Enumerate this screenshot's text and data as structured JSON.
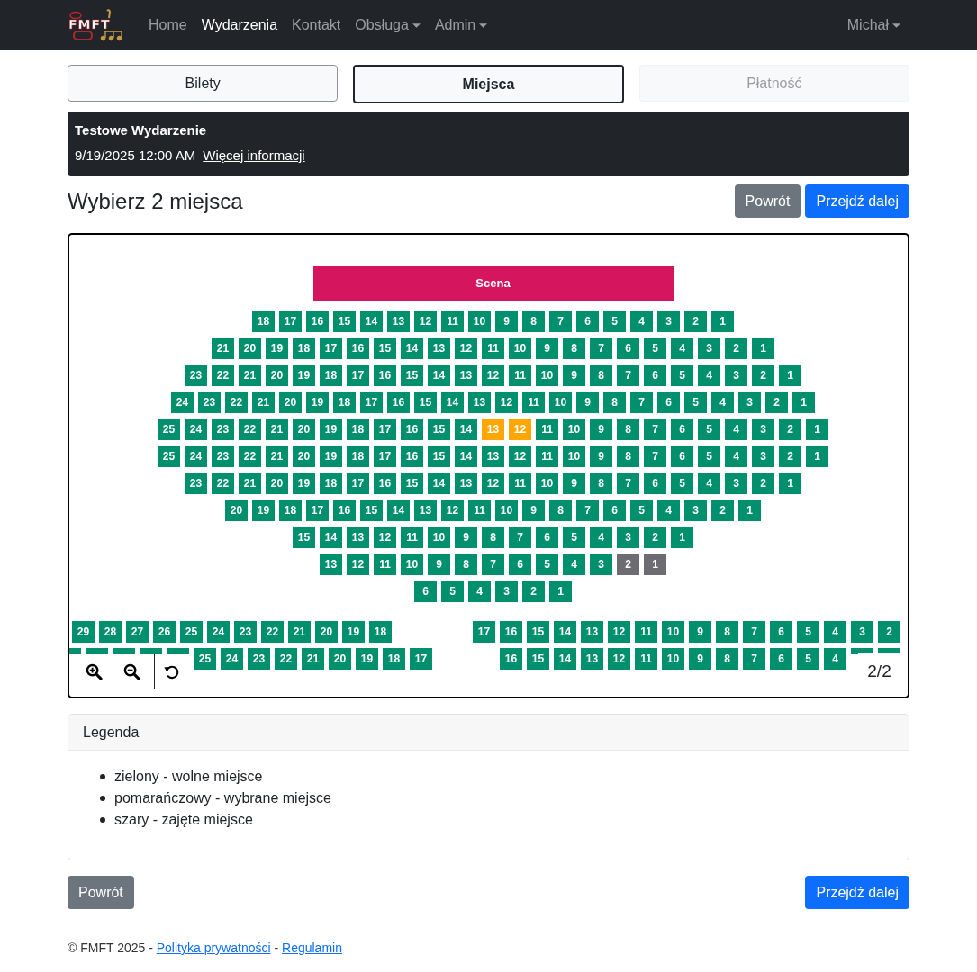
{
  "navbar": {
    "logo_text": "FMFT",
    "links": [
      {
        "label": "Home",
        "selected": false,
        "dropdown": false
      },
      {
        "label": "Wydarzenia",
        "selected": true,
        "dropdown": false
      },
      {
        "label": "Kontakt",
        "selected": false,
        "dropdown": false
      },
      {
        "label": "Obsługa",
        "selected": false,
        "dropdown": true
      },
      {
        "label": "Admin",
        "selected": false,
        "dropdown": true
      }
    ],
    "user": {
      "label": "Michał",
      "dropdown": true
    }
  },
  "steps": [
    {
      "label": "Bilety",
      "selected": false,
      "disabled": false
    },
    {
      "label": "Miejsca",
      "selected": true,
      "disabled": false
    },
    {
      "label": "Płatność",
      "selected": false,
      "disabled": true
    }
  ],
  "event": {
    "title": "Testowe Wydarzenie",
    "datetime": "9/19/2025 12:00 AM",
    "link": "Więcej informacji"
  },
  "heading": "Wybierz 2 miejsca",
  "top_buttons": [
    {
      "label": "Powrót",
      "kind": "secondary"
    },
    {
      "label": "Przejdź dalej",
      "kind": "primary"
    }
  ],
  "seat_map": {
    "stage": "Scena",
    "rows": [
      {
        "seats": [
          {
            "label": "18",
            "selected": false,
            "taken": false
          },
          {
            "label": "17",
            "selected": false,
            "taken": false
          },
          {
            "label": "16",
            "selected": false,
            "taken": false
          },
          {
            "label": "15",
            "selected": false,
            "taken": false
          },
          {
            "label": "14",
            "selected": false,
            "taken": false
          },
          {
            "label": "13",
            "selected": false,
            "taken": false
          },
          {
            "label": "12",
            "selected": false,
            "taken": false
          },
          {
            "label": "11",
            "selected": false,
            "taken": false
          },
          {
            "label": "10",
            "selected": false,
            "taken": false
          },
          {
            "label": "9",
            "selected": false,
            "taken": false
          },
          {
            "label": "8",
            "selected": false,
            "taken": false
          },
          {
            "label": "7",
            "selected": false,
            "taken": false
          },
          {
            "label": "6",
            "selected": false,
            "taken": false
          },
          {
            "label": "5",
            "selected": false,
            "taken": false
          },
          {
            "label": "4",
            "selected": false,
            "taken": false
          },
          {
            "label": "3",
            "selected": false,
            "taken": false
          },
          {
            "label": "2",
            "selected": false,
            "taken": false
          },
          {
            "label": "1",
            "selected": false,
            "taken": false
          }
        ]
      },
      {
        "seats": [
          {
            "label": "21",
            "selected": false,
            "taken": false
          },
          {
            "label": "20",
            "selected": false,
            "taken": false
          },
          {
            "label": "19",
            "selected": false,
            "taken": false
          },
          {
            "label": "18",
            "selected": false,
            "taken": false
          },
          {
            "label": "17",
            "selected": false,
            "taken": false
          },
          {
            "label": "16",
            "selected": false,
            "taken": false
          },
          {
            "label": "15",
            "selected": false,
            "taken": false
          },
          {
            "label": "14",
            "selected": false,
            "taken": false
          },
          {
            "label": "13",
            "selected": false,
            "taken": false
          },
          {
            "label": "12",
            "selected": false,
            "taken": false
          },
          {
            "label": "11",
            "selected": false,
            "taken": false
          },
          {
            "label": "10",
            "selected": false,
            "taken": false
          },
          {
            "label": "9",
            "selected": false,
            "taken": false
          },
          {
            "label": "8",
            "selected": false,
            "taken": false
          },
          {
            "label": "7",
            "selected": false,
            "taken": false
          },
          {
            "label": "6",
            "selected": false,
            "taken": false
          },
          {
            "label": "5",
            "selected": false,
            "taken": false
          },
          {
            "label": "4",
            "selected": false,
            "taken": false
          },
          {
            "label": "3",
            "selected": false,
            "taken": false
          },
          {
            "label": "2",
            "selected": false,
            "taken": false
          },
          {
            "label": "1",
            "selected": false,
            "taken": false
          }
        ]
      },
      {
        "seats": [
          {
            "label": "23",
            "selected": false,
            "taken": false
          },
          {
            "label": "22",
            "selected": false,
            "taken": false
          },
          {
            "label": "21",
            "selected": false,
            "taken": false
          },
          {
            "label": "20",
            "selected": false,
            "taken": false
          },
          {
            "label": "19",
            "selected": false,
            "taken": false
          },
          {
            "label": "18",
            "selected": false,
            "taken": false
          },
          {
            "label": "17",
            "selected": false,
            "taken": false
          },
          {
            "label": "16",
            "selected": false,
            "taken": false
          },
          {
            "label": "15",
            "selected": false,
            "taken": false
          },
          {
            "label": "14",
            "selected": false,
            "taken": false
          },
          {
            "label": "13",
            "selected": false,
            "taken": false
          },
          {
            "label": "12",
            "selected": false,
            "taken": false
          },
          {
            "label": "11",
            "selected": false,
            "taken": false
          },
          {
            "label": "10",
            "selected": false,
            "taken": false
          },
          {
            "label": "9",
            "selected": false,
            "taken": false
          },
          {
            "label": "8",
            "selected": false,
            "taken": false
          },
          {
            "label": "7",
            "selected": false,
            "taken": false
          },
          {
            "label": "6",
            "selected": false,
            "taken": false
          },
          {
            "label": "5",
            "selected": false,
            "taken": false
          },
          {
            "label": "4",
            "selected": false,
            "taken": false
          },
          {
            "label": "3",
            "selected": false,
            "taken": false
          },
          {
            "label": "2",
            "selected": false,
            "taken": false
          },
          {
            "label": "1",
            "selected": false,
            "taken": false
          }
        ]
      },
      {
        "seats": [
          {
            "label": "24",
            "selected": false,
            "taken": false
          },
          {
            "label": "23",
            "selected": false,
            "taken": false
          },
          {
            "label": "22",
            "selected": false,
            "taken": false
          },
          {
            "label": "21",
            "selected": false,
            "taken": false
          },
          {
            "label": "20",
            "selected": false,
            "taken": false
          },
          {
            "label": "19",
            "selected": false,
            "taken": false
          },
          {
            "label": "18",
            "selected": false,
            "taken": false
          },
          {
            "label": "17",
            "selected": false,
            "taken": false
          },
          {
            "label": "16",
            "selected": false,
            "taken": false
          },
          {
            "label": "15",
            "selected": false,
            "taken": false
          },
          {
            "label": "14",
            "selected": false,
            "taken": false
          },
          {
            "label": "13",
            "selected": false,
            "taken": false
          },
          {
            "label": "12",
            "selected": false,
            "taken": false
          },
          {
            "label": "11",
            "selected": false,
            "taken": false
          },
          {
            "label": "10",
            "selected": false,
            "taken": false
          },
          {
            "label": "9",
            "selected": false,
            "taken": false
          },
          {
            "label": "8",
            "selected": false,
            "taken": false
          },
          {
            "label": "7",
            "selected": false,
            "taken": false
          },
          {
            "label": "6",
            "selected": false,
            "taken": false
          },
          {
            "label": "5",
            "selected": false,
            "taken": false
          },
          {
            "label": "4",
            "selected": false,
            "taken": false
          },
          {
            "label": "3",
            "selected": false,
            "taken": false
          },
          {
            "label": "2",
            "selected": false,
            "taken": false
          },
          {
            "label": "1",
            "selected": false,
            "taken": false
          }
        ]
      },
      {
        "seats": [
          {
            "label": "25",
            "selected": false,
            "taken": false
          },
          {
            "label": "24",
            "selected": false,
            "taken": false
          },
          {
            "label": "23",
            "selected": false,
            "taken": false
          },
          {
            "label": "22",
            "selected": false,
            "taken": false
          },
          {
            "label": "21",
            "selected": false,
            "taken": false
          },
          {
            "label": "20",
            "selected": false,
            "taken": false
          },
          {
            "label": "19",
            "selected": false,
            "taken": false
          },
          {
            "label": "18",
            "selected": false,
            "taken": false
          },
          {
            "label": "17",
            "selected": false,
            "taken": false
          },
          {
            "label": "16",
            "selected": false,
            "taken": false
          },
          {
            "label": "15",
            "selected": false,
            "taken": false
          },
          {
            "label": "14",
            "selected": false,
            "taken": false
          },
          {
            "label": "13",
            "selected": true,
            "taken": false
          },
          {
            "label": "12",
            "selected": true,
            "taken": false
          },
          {
            "label": "11",
            "selected": false,
            "taken": false
          },
          {
            "label": "10",
            "selected": false,
            "taken": false
          },
          {
            "label": "9",
            "selected": false,
            "taken": false
          },
          {
            "label": "8",
            "selected": false,
            "taken": false
          },
          {
            "label": "7",
            "selected": false,
            "taken": false
          },
          {
            "label": "6",
            "selected": false,
            "taken": false
          },
          {
            "label": "5",
            "selected": false,
            "taken": false
          },
          {
            "label": "4",
            "selected": false,
            "taken": false
          },
          {
            "label": "3",
            "selected": false,
            "taken": false
          },
          {
            "label": "2",
            "selected": false,
            "taken": false
          },
          {
            "label": "1",
            "selected": false,
            "taken": false
          }
        ]
      },
      {
        "seats": [
          {
            "label": "25",
            "selected": false,
            "taken": false
          },
          {
            "label": "24",
            "selected": false,
            "taken": false
          },
          {
            "label": "23",
            "selected": false,
            "taken": false
          },
          {
            "label": "22",
            "selected": false,
            "taken": false
          },
          {
            "label": "21",
            "selected": false,
            "taken": false
          },
          {
            "label": "20",
            "selected": false,
            "taken": false
          },
          {
            "label": "19",
            "selected": false,
            "taken": false
          },
          {
            "label": "18",
            "selected": false,
            "taken": false
          },
          {
            "label": "17",
            "selected": false,
            "taken": false
          },
          {
            "label": "16",
            "selected": false,
            "taken": false
          },
          {
            "label": "15",
            "selected": false,
            "taken": false
          },
          {
            "label": "14",
            "selected": false,
            "taken": false
          },
          {
            "label": "13",
            "selected": false,
            "taken": false
          },
          {
            "label": "12",
            "selected": false,
            "taken": false
          },
          {
            "label": "11",
            "selected": false,
            "taken": false
          },
          {
            "label": "10",
            "selected": false,
            "taken": false
          },
          {
            "label": "9",
            "selected": false,
            "taken": false
          },
          {
            "label": "8",
            "selected": false,
            "taken": false
          },
          {
            "label": "7",
            "selected": false,
            "taken": false
          },
          {
            "label": "6",
            "selected": false,
            "taken": false
          },
          {
            "label": "5",
            "selected": false,
            "taken": false
          },
          {
            "label": "4",
            "selected": false,
            "taken": false
          },
          {
            "label": "3",
            "selected": false,
            "taken": false
          },
          {
            "label": "2",
            "selected": false,
            "taken": false
          },
          {
            "label": "1",
            "selected": false,
            "taken": false
          }
        ]
      },
      {
        "seats": [
          {
            "label": "23",
            "selected": false,
            "taken": false
          },
          {
            "label": "22",
            "selected": false,
            "taken": false
          },
          {
            "label": "21",
            "selected": false,
            "taken": false
          },
          {
            "label": "20",
            "selected": false,
            "taken": false
          },
          {
            "label": "19",
            "selected": false,
            "taken": false
          },
          {
            "label": "18",
            "selected": false,
            "taken": false
          },
          {
            "label": "17",
            "selected": false,
            "taken": false
          },
          {
            "label": "16",
            "selected": false,
            "taken": false
          },
          {
            "label": "15",
            "selected": false,
            "taken": false
          },
          {
            "label": "14",
            "selected": false,
            "taken": false
          },
          {
            "label": "13",
            "selected": false,
            "taken": false
          },
          {
            "label": "12",
            "selected": false,
            "taken": false
          },
          {
            "label": "11",
            "selected": false,
            "taken": false
          },
          {
            "label": "10",
            "selected": false,
            "taken": false
          },
          {
            "label": "9",
            "selected": false,
            "taken": false
          },
          {
            "label": "8",
            "selected": false,
            "taken": false
          },
          {
            "label": "7",
            "selected": false,
            "taken": false
          },
          {
            "label": "6",
            "selected": false,
            "taken": false
          },
          {
            "label": "5",
            "selected": false,
            "taken": false
          },
          {
            "label": "4",
            "selected": false,
            "taken": false
          },
          {
            "label": "3",
            "selected": false,
            "taken": false
          },
          {
            "label": "2",
            "selected": false,
            "taken": false
          },
          {
            "label": "1",
            "selected": false,
            "taken": false
          }
        ]
      },
      {
        "seats": [
          {
            "label": "20",
            "selected": false,
            "taken": false
          },
          {
            "label": "19",
            "selected": false,
            "taken": false
          },
          {
            "label": "18",
            "selected": false,
            "taken": false
          },
          {
            "label": "17",
            "selected": false,
            "taken": false
          },
          {
            "label": "16",
            "selected": false,
            "taken": false
          },
          {
            "label": "15",
            "selected": false,
            "taken": false
          },
          {
            "label": "14",
            "selected": false,
            "taken": false
          },
          {
            "label": "13",
            "selected": false,
            "taken": false
          },
          {
            "label": "12",
            "selected": false,
            "taken": false
          },
          {
            "label": "11",
            "selected": false,
            "taken": false
          },
          {
            "label": "10",
            "selected": false,
            "taken": false
          },
          {
            "label": "9",
            "selected": false,
            "taken": false
          },
          {
            "label": "8",
            "selected": false,
            "taken": false
          },
          {
            "label": "7",
            "selected": false,
            "taken": false
          },
          {
            "label": "6",
            "selected": false,
            "taken": false
          },
          {
            "label": "5",
            "selected": false,
            "taken": false
          },
          {
            "label": "4",
            "selected": false,
            "taken": false
          },
          {
            "label": "3",
            "selected": false,
            "taken": false
          },
          {
            "label": "2",
            "selected": false,
            "taken": false
          },
          {
            "label": "1",
            "selected": false,
            "taken": false
          }
        ]
      },
      {
        "seats": [
          {
            "label": "15",
            "selected": false,
            "taken": false
          },
          {
            "label": "14",
            "selected": false,
            "taken": false
          },
          {
            "label": "13",
            "selected": false,
            "taken": false
          },
          {
            "label": "12",
            "selected": false,
            "taken": false
          },
          {
            "label": "11",
            "selected": false,
            "taken": false
          },
          {
            "label": "10",
            "selected": false,
            "taken": false
          },
          {
            "label": "9",
            "selected": false,
            "taken": false
          },
          {
            "label": "8",
            "selected": false,
            "taken": false
          },
          {
            "label": "7",
            "selected": false,
            "taken": false
          },
          {
            "label": "6",
            "selected": false,
            "taken": false
          },
          {
            "label": "5",
            "selected": false,
            "taken": false
          },
          {
            "label": "4",
            "selected": false,
            "taken": false
          },
          {
            "label": "3",
            "selected": false,
            "taken": false
          },
          {
            "label": "2",
            "selected": false,
            "taken": false
          },
          {
            "label": "1",
            "selected": false,
            "taken": false
          }
        ]
      },
      {
        "seats": [
          {
            "label": "13",
            "selected": false,
            "taken": false
          },
          {
            "label": "12",
            "selected": false,
            "taken": false
          },
          {
            "label": "11",
            "selected": false,
            "taken": false
          },
          {
            "label": "10",
            "selected": false,
            "taken": false
          },
          {
            "label": "9",
            "selected": false,
            "taken": false
          },
          {
            "label": "8",
            "selected": false,
            "taken": false
          },
          {
            "label": "7",
            "selected": false,
            "taken": false
          },
          {
            "label": "6",
            "selected": false,
            "taken": false
          },
          {
            "label": "5",
            "selected": false,
            "taken": false
          },
          {
            "label": "4",
            "selected": false,
            "taken": false
          },
          {
            "label": "3",
            "selected": false,
            "taken": false
          },
          {
            "label": "2",
            "selected": false,
            "taken": true
          },
          {
            "label": "1",
            "selected": false,
            "taken": true
          }
        ]
      },
      {
        "seats": [
          {
            "label": "6",
            "selected": false,
            "taken": false
          },
          {
            "label": "5",
            "selected": false,
            "taken": false
          },
          {
            "label": "4",
            "selected": false,
            "taken": false
          },
          {
            "label": "3",
            "selected": false,
            "taken": false
          },
          {
            "label": "2",
            "selected": false,
            "taken": false
          },
          {
            "label": "1",
            "selected": false,
            "taken": false
          }
        ]
      }
    ],
    "balcony_rows": [
      {
        "left": [
          {
            "label": "29",
            "selected": false,
            "taken": false
          },
          {
            "label": "28",
            "selected": false,
            "taken": false
          },
          {
            "label": "27",
            "selected": false,
            "taken": false
          },
          {
            "label": "26",
            "selected": false,
            "taken": false
          },
          {
            "label": "25",
            "selected": false,
            "taken": false
          },
          {
            "label": "24",
            "selected": false,
            "taken": false
          },
          {
            "label": "23",
            "selected": false,
            "taken": false
          },
          {
            "label": "22",
            "selected": false,
            "taken": false
          },
          {
            "label": "21",
            "selected": false,
            "taken": false
          },
          {
            "label": "20",
            "selected": false,
            "taken": false
          },
          {
            "label": "19",
            "selected": false,
            "taken": false
          },
          {
            "label": "18",
            "selected": false,
            "taken": false
          }
        ],
        "right": [
          {
            "label": "17",
            "selected": false,
            "taken": false
          },
          {
            "label": "16",
            "selected": false,
            "taken": false
          },
          {
            "label": "15",
            "selected": false,
            "taken": false
          },
          {
            "label": "14",
            "selected": false,
            "taken": false
          },
          {
            "label": "13",
            "selected": false,
            "taken": false
          },
          {
            "label": "12",
            "selected": false,
            "taken": false
          },
          {
            "label": "11",
            "selected": false,
            "taken": false
          },
          {
            "label": "10",
            "selected": false,
            "taken": false
          },
          {
            "label": "9",
            "selected": false,
            "taken": false
          },
          {
            "label": "8",
            "selected": false,
            "taken": false
          },
          {
            "label": "7",
            "selected": false,
            "taken": false
          },
          {
            "label": "6",
            "selected": false,
            "taken": false
          },
          {
            "label": "5",
            "selected": false,
            "taken": false
          },
          {
            "label": "4",
            "selected": false,
            "taken": false
          },
          {
            "label": "3",
            "selected": false,
            "taken": false
          },
          {
            "label": "2",
            "selected": false,
            "taken": false
          }
        ]
      },
      {
        "left_partial": [
          {
            "selected": false,
            "taken": false
          },
          {
            "selected": false,
            "taken": false
          },
          {
            "selected": false,
            "taken": false
          },
          {
            "selected": false,
            "taken": false
          },
          {
            "selected": false,
            "taken": false
          }
        ],
        "left": [
          {
            "label": "25",
            "selected": false,
            "taken": false
          },
          {
            "label": "24",
            "selected": false,
            "taken": false
          },
          {
            "label": "23",
            "selected": false,
            "taken": false
          },
          {
            "label": "22",
            "selected": false,
            "taken": false
          },
          {
            "label": "21",
            "selected": false,
            "taken": false
          },
          {
            "label": "20",
            "selected": false,
            "taken": false
          },
          {
            "label": "19",
            "selected": false,
            "taken": false
          },
          {
            "label": "18",
            "selected": false,
            "taken": false
          },
          {
            "label": "17",
            "selected": false,
            "taken": false
          }
        ],
        "right": [
          {
            "label": "16",
            "selected": false,
            "taken": false
          },
          {
            "label": "15",
            "selected": false,
            "taken": false
          },
          {
            "label": "14",
            "selected": false,
            "taken": false
          },
          {
            "label": "13",
            "selected": false,
            "taken": false
          },
          {
            "label": "12",
            "selected": false,
            "taken": false
          },
          {
            "label": "11",
            "selected": false,
            "taken": false
          },
          {
            "label": "10",
            "selected": false,
            "taken": false
          },
          {
            "label": "9",
            "selected": false,
            "taken": false
          },
          {
            "label": "8",
            "selected": false,
            "taken": false
          },
          {
            "label": "7",
            "selected": false,
            "taken": false
          },
          {
            "label": "6",
            "selected": false,
            "taken": false
          },
          {
            "label": "5",
            "selected": false,
            "taken": false
          },
          {
            "label": "4",
            "selected": false,
            "taken": false
          }
        ],
        "right_partial": [
          {
            "selected": false,
            "taken": false
          },
          {
            "selected": false,
            "taken": false
          }
        ]
      }
    ],
    "page_indicator": "2/2"
  },
  "legend": {
    "title": "Legenda",
    "items": [
      "zielony - wolne miejsce",
      "pomarańczowy - wybrane miejsce",
      "szary - zajęte miejsce"
    ]
  },
  "bottom_buttons": [
    {
      "label": "Powrót",
      "kind": "secondary"
    },
    {
      "label": "Przejdź dalej",
      "kind": "primary"
    }
  ],
  "footer": {
    "parts": [
      {
        "text": "© FMFT 2025 - ",
        "kind": "text"
      },
      {
        "text": "Polityka prywatności",
        "kind": "link"
      },
      {
        "text": " - ",
        "kind": "text"
      },
      {
        "text": "Regulamin",
        "kind": "link"
      }
    ]
  }
}
